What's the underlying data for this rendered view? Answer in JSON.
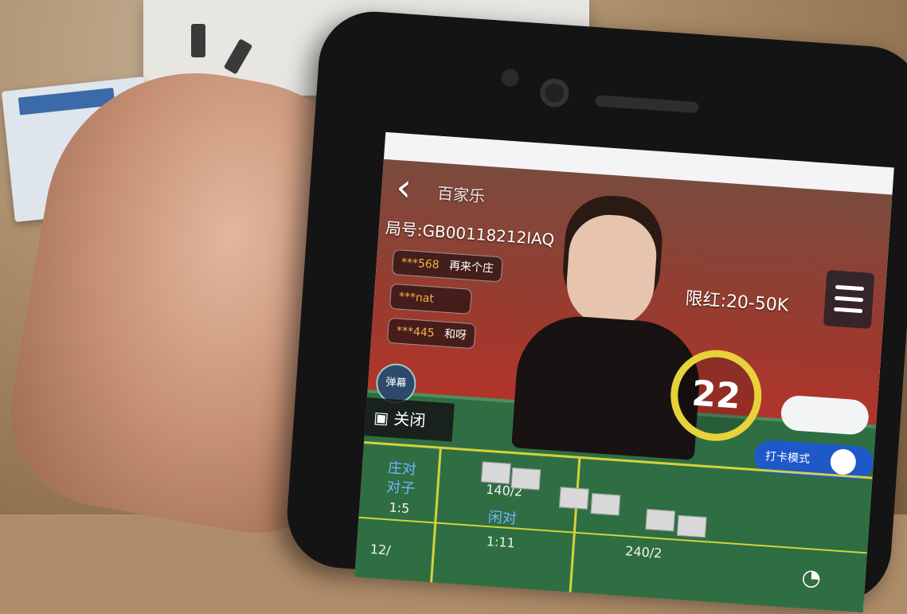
{
  "game": {
    "room_title": "百家乐",
    "round_number": "局号:GB00118212IAQ",
    "bet_limit": "限红:20-50K",
    "countdown": "22",
    "messages": [
      {
        "nick": "***568",
        "text": "再来个庄"
      },
      {
        "nick": "***nat",
        "text": ""
      },
      {
        "nick": "***445",
        "text": "和呀"
      }
    ],
    "bubble_label": "弹幕",
    "close_label": "关闭",
    "toggle_label": "打卡模式"
  },
  "betting_board": {
    "cells": [
      {
        "label": "庄对",
        "sub": "对子",
        "odds": "1:5"
      },
      {
        "label": "",
        "count": "140/2",
        "sub": "闲对",
        "odds": "1:11"
      },
      {
        "label": "",
        "count": "240/2",
        "sub": "",
        "odds": ""
      }
    ],
    "bottom_count": "12/"
  },
  "icons": {
    "back": "chevron-left-icon",
    "menu": "hamburger-menu-icon",
    "camera": "video-camera-icon",
    "wifi": "wifi-icon"
  },
  "colors": {
    "timer_ring": "#e6d23a",
    "table_felt": "#2f6e43",
    "toggle_blue": "#1f58c9"
  }
}
